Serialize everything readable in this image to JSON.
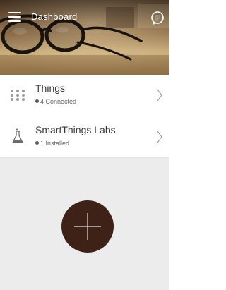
{
  "header": {
    "title": "Dashboard",
    "menu_icon": "hamburger-menu-icon",
    "chat_icon": "chat-bubble-icon"
  },
  "rows": [
    {
      "title": "Things",
      "subtitle": "4 Connected",
      "icon": "grid-dots-icon",
      "chevron": "chevron-right-icon"
    },
    {
      "title": "SmartThings Labs",
      "subtitle": "1 Installed",
      "icon": "flask-icon",
      "chevron": "chevron-right-icon"
    }
  ],
  "add_button": {
    "icon": "plus-icon",
    "color": "#3e2218"
  },
  "colors": {
    "background": "#ececec",
    "row_background": "#ffffff",
    "divider": "#e2e2e2",
    "icon_gray": "#9a9a9a"
  }
}
